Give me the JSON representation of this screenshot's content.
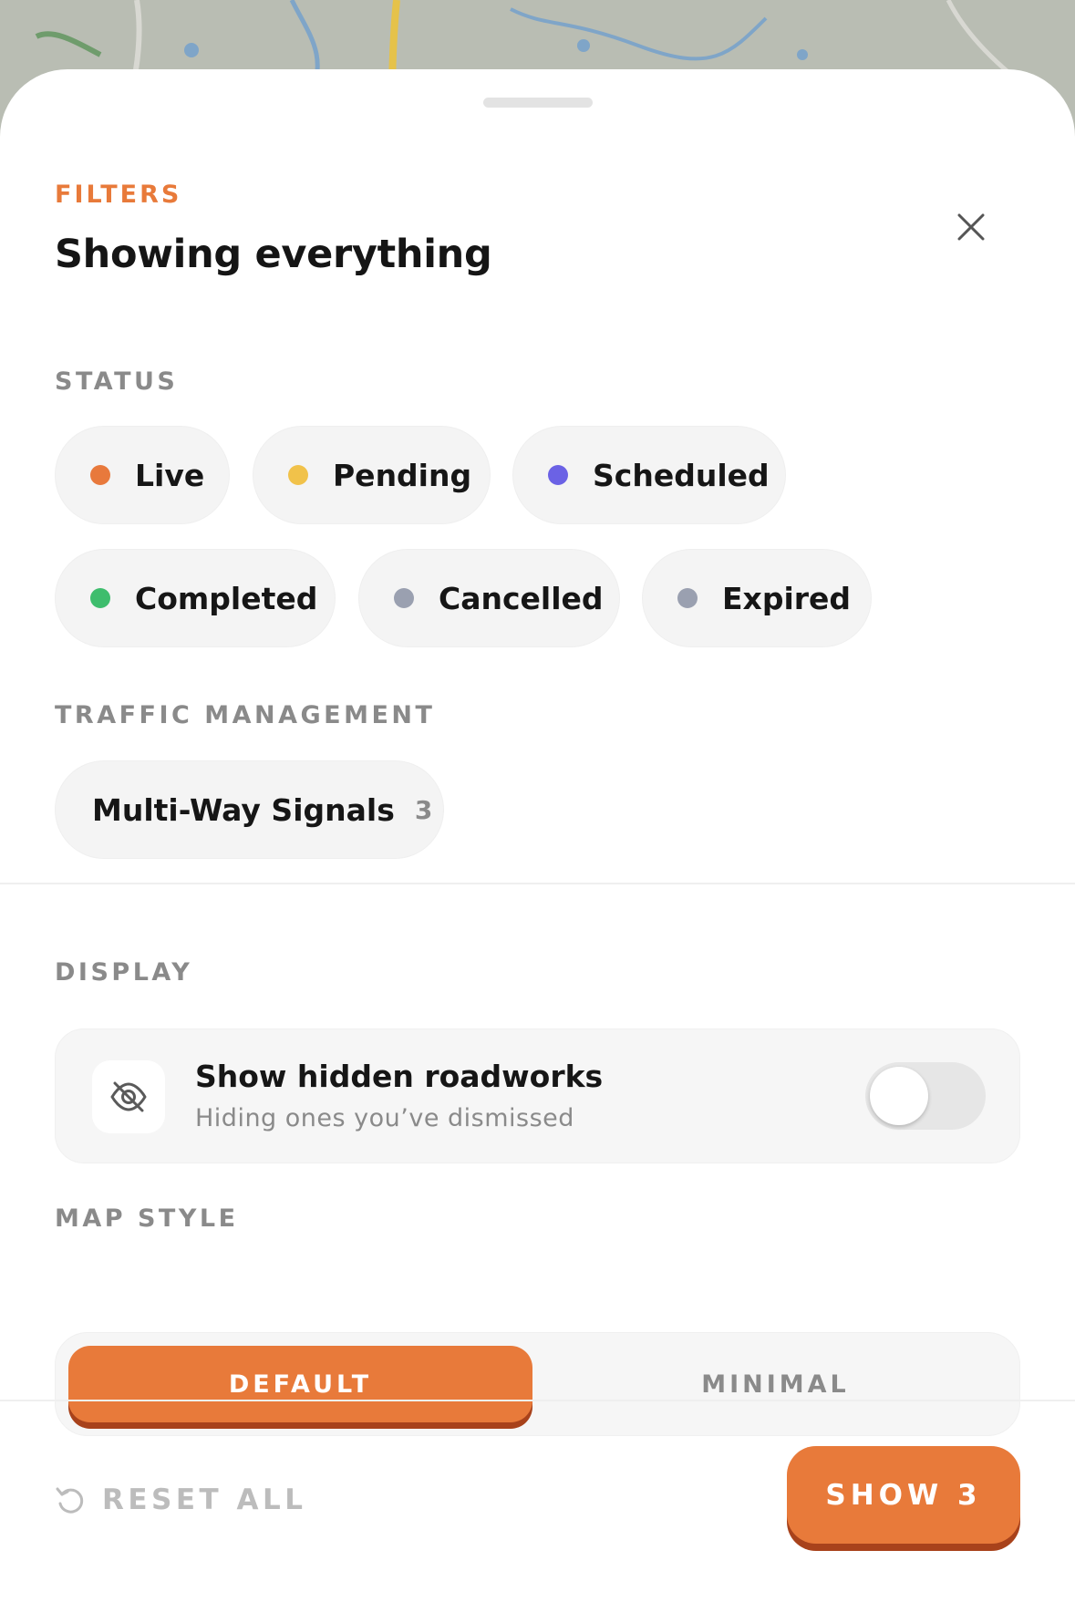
{
  "header": {
    "eyebrow": "FILTERS",
    "title": "Showing everything"
  },
  "status": {
    "label": "STATUS",
    "chips": [
      {
        "label": "Live",
        "color": "#e8793c"
      },
      {
        "label": "Pending",
        "color": "#f1c24a"
      },
      {
        "label": "Scheduled",
        "color": "#6b62e5"
      },
      {
        "label": "Completed",
        "color": "#3ebd6d"
      },
      {
        "label": "Cancelled",
        "color": "#9aa0b0"
      },
      {
        "label": "Expired",
        "color": "#9aa0b0"
      }
    ]
  },
  "traffic": {
    "label": "TRAFFIC MANAGEMENT",
    "chips": [
      {
        "label": "Multi-Way Signals",
        "count": "3"
      }
    ]
  },
  "display": {
    "label": "DISPLAY",
    "hidden_roadworks": {
      "title": "Show hidden roadworks",
      "subtitle": "Hiding ones you’ve dismissed",
      "icon": "eye-off-icon",
      "enabled": false
    }
  },
  "map_style": {
    "label": "MAP STYLE",
    "options": [
      "DEFAULT",
      "MINIMAL"
    ],
    "selected": "DEFAULT"
  },
  "footer": {
    "reset_label": "RESET ALL",
    "show_label": "SHOW 3"
  },
  "colors": {
    "accent": "#e87a3a",
    "accent_shadow": "#a8421b"
  }
}
